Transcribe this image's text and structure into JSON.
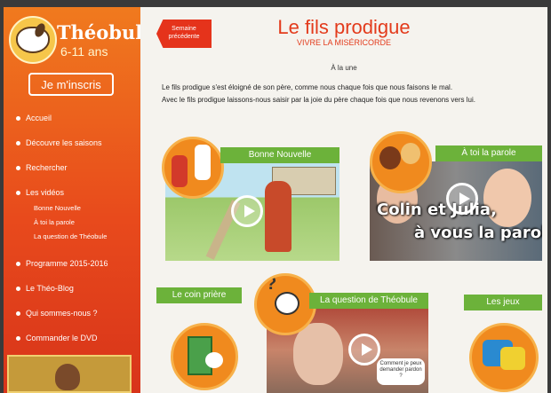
{
  "sidebar": {
    "brand_name": "Théobule",
    "brand_age": "6-11 ans",
    "signup_label": "Je m'inscris",
    "nav": [
      {
        "label": "Accueil"
      },
      {
        "label": "Découvre les saisons"
      },
      {
        "label": "Rechercher"
      },
      {
        "label": "Les vidéos"
      },
      {
        "label": "Programme 2015-2016"
      },
      {
        "label": "Le Théo-Blog"
      },
      {
        "label": "Qui sommes-nous ?"
      },
      {
        "label": "Commander le DVD"
      }
    ],
    "video_subitems": [
      {
        "label": "Bonne Nouvelle"
      },
      {
        "label": "À toi la parole"
      },
      {
        "label": "La question de Théobule"
      }
    ]
  },
  "main": {
    "prev_week_label": "Semaine précédente",
    "title": "Le fils prodigue",
    "subtitle": "VIVRE LA MISÉRICORDE",
    "section_label": "À la une",
    "intro_line1": "Le fils prodigue s'est éloigné de son père, comme nous chaque fois que nous faisons le mal.",
    "intro_line2": "Avec le fils prodigue laissons-nous saisir par la joie du père chaque fois que nous revenons vers lui.",
    "cards": {
      "bonne_nouvelle": "Bonne Nouvelle",
      "a_toi_la_parole": "À toi la parole",
      "overlay_line1": "Colin et Julia,",
      "overlay_line2": "à vous la parole !",
      "coin_priere": "Le coin prière",
      "question_theobule": "La question de Théobule",
      "jeux": "Les jeux",
      "speech_bubble": "Comment je peux demander pardon ?"
    }
  },
  "colors": {
    "sidebar_top": "#f07a1e",
    "sidebar_bottom": "#d8341a",
    "accent_red": "#e33b1c",
    "banner_green": "#6cb23a"
  }
}
